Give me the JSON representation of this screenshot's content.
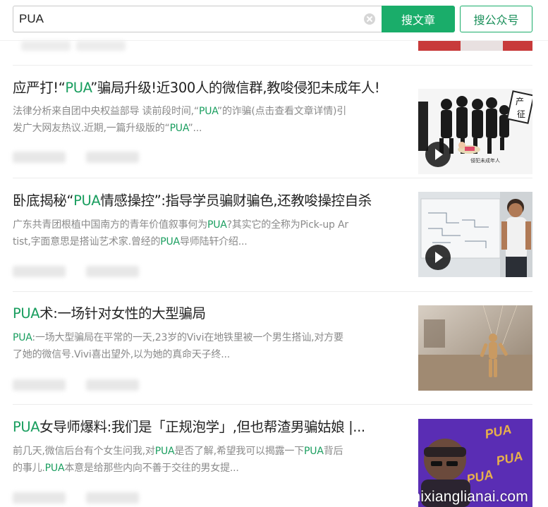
{
  "search": {
    "query": "PUA",
    "article_button": "搜文章",
    "account_button": "搜公众号"
  },
  "results": [
    {
      "title_parts": [
        "应严打!“",
        "PUA",
        "”骗局升级!近300人的微信群,教唆侵犯未成年人!"
      ],
      "desc_line1_parts": [
        "法律分析来自团中央权益部导 读前段时间,“",
        "PUA",
        "”的诈骗(点击查看文章详情)引"
      ],
      "desc_line2_parts": [
        "发广大网友热议.近期,一篇升级版的“",
        "PUA",
        "”..."
      ],
      "thumb_text_1": "产",
      "thumb_text_2": "征",
      "thumb_caption": "侵犯未成年人"
    },
    {
      "title_parts": [
        "卧底揭秘“",
        "PUA",
        "情感操控”:指导学员骗财骗色,还教唆操控自杀"
      ],
      "desc_line1_parts": [
        "广东共青团根植中国南方的青年价值叙事何为",
        "PUA",
        "?其实它的全称为Pick-up Ar"
      ],
      "desc_line2_parts": [
        "tist,字面意思是搭讪艺术家.曾经的",
        "PUA",
        "导师陆轩介绍..."
      ]
    },
    {
      "title_parts": [
        "",
        "PUA",
        "术:一场针对女性的大型骗局"
      ],
      "desc_line1_parts": [
        "",
        "PUA",
        ":一场大型骗局在平常的一天,23岁的Vivi在地铁里被一个男生搭讪,对方要"
      ],
      "desc_line2_parts": [
        "了她的微信号.Vivi喜出望外,以为她的真命天子终..."
      ]
    },
    {
      "title_parts": [
        "",
        "PUA",
        "女导师爆料:我们是「正规泡学」,但也帮渣男骗姑娘 |..."
      ],
      "desc_line1_parts": [
        "前几天,微信后台有个女生问我,对",
        "PUA",
        "是否了解,希望我可以揭露一下",
        "PUA",
        "背后"
      ],
      "desc_line2_parts": [
        "的事儿.",
        "PUA",
        "本意是给那些内向不善于交往的男女提..."
      ],
      "thumb_text": "PUA"
    }
  ],
  "watermark": "www.nixianglianai.com",
  "colors": {
    "accent": "#1aad6a",
    "highlight": "#1a9e5f",
    "desc": "#8a8a8a"
  }
}
